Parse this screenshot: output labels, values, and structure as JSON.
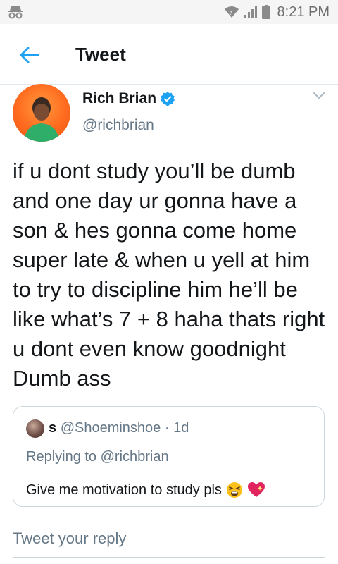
{
  "status_bar": {
    "time": "8:21 PM",
    "icons": [
      "incognito-icon",
      "wifi-icon",
      "signal-icon",
      "battery-icon"
    ]
  },
  "header": {
    "title": "Tweet",
    "back_icon": "back-arrow-icon"
  },
  "tweet": {
    "author_name": "Rich Brian",
    "author_handle": "@richbrian",
    "verified": true,
    "text": "if u dont study you’ll be dumb and one day ur gonna have a son & hes gonna come home super late & when u yell at him to try to discipline him he’ll be like what’s 7 + 8 haha thats right u dont even know goodnight Dumb ass"
  },
  "quoted": {
    "name": "s",
    "handle": "@Shoeminshoe",
    "separator": "·",
    "age": "1d",
    "replying_to": "Replying to @richbrian",
    "text": "Give me motivation to study pls",
    "emojis": [
      "tired-face-emoji",
      "sparkling-heart-emoji"
    ]
  },
  "reply": {
    "placeholder": "Tweet your reply"
  },
  "colors": {
    "accent": "#1da1f2",
    "text": "#14171a",
    "secondary": "#657786",
    "border": "#ccd6dd",
    "avatar_bg": "#ff6a1f"
  }
}
